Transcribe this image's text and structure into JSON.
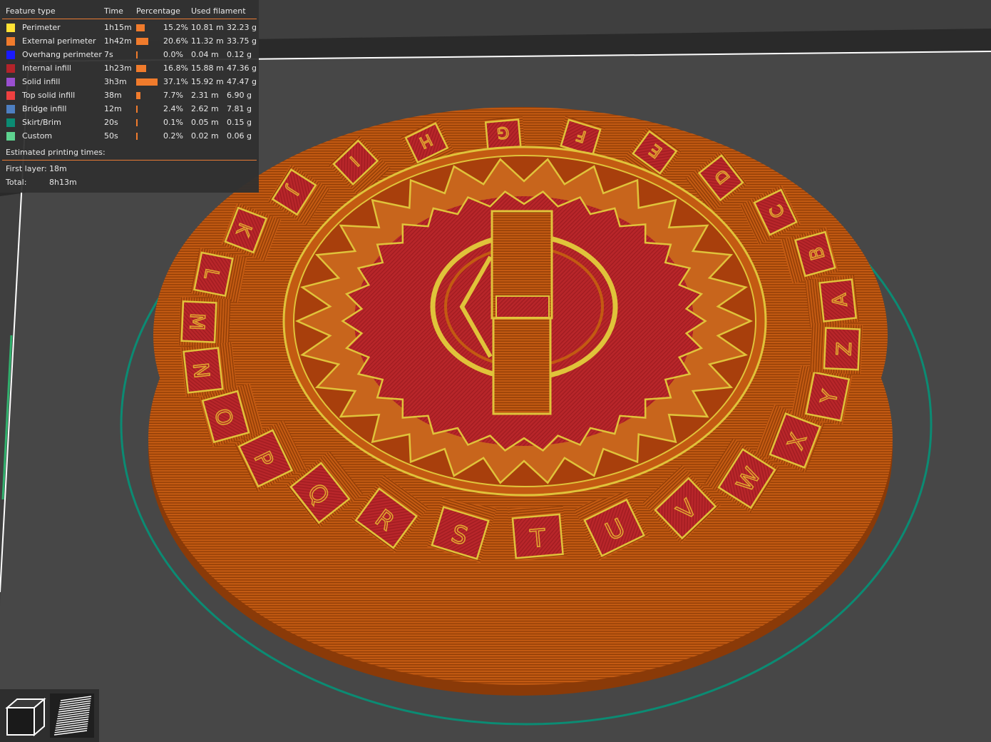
{
  "legend": {
    "headers": {
      "feature": "Feature type",
      "time": "Time",
      "percentage": "Percentage",
      "used": "Used filament"
    },
    "rows": [
      {
        "name": "Perimeter",
        "color": "#ffe234",
        "time": "1h15m",
        "pct": "15.2%",
        "pct_value": 15.2,
        "length": "10.81 m",
        "weight": "32.23 g"
      },
      {
        "name": "External perimeter",
        "color": "#f07b2c",
        "time": "1h42m",
        "pct": "20.6%",
        "pct_value": 20.6,
        "length": "11.32 m",
        "weight": "33.75 g"
      },
      {
        "name": "Overhang perimeter",
        "color": "#1a1aff",
        "time": "7s",
        "pct": "0.0%",
        "pct_value": 0.0,
        "length": "0.04 m",
        "weight": "0.12 g"
      },
      {
        "name": "Internal infill",
        "color": "#b3232a",
        "time": "1h23m",
        "pct": "16.8%",
        "pct_value": 16.8,
        "length": "15.88 m",
        "weight": "47.36 g"
      },
      {
        "name": "Solid infill",
        "color": "#9a4fd0",
        "time": "3h3m",
        "pct": "37.1%",
        "pct_value": 37.1,
        "length": "15.92 m",
        "weight": "47.47 g"
      },
      {
        "name": "Top solid infill",
        "color": "#ee4040",
        "time": "38m",
        "pct": "7.7%",
        "pct_value": 7.7,
        "length": "2.31 m",
        "weight": "6.90 g"
      },
      {
        "name": "Bridge infill",
        "color": "#4e7fc1",
        "time": "12m",
        "pct": "2.4%",
        "pct_value": 2.4,
        "length": "2.62 m",
        "weight": "7.81 g"
      },
      {
        "name": "Skirt/Brim",
        "color": "#0b8b73",
        "time": "20s",
        "pct": "0.1%",
        "pct_value": 0.1,
        "length": "0.05 m",
        "weight": "0.15 g"
      },
      {
        "name": "Custom",
        "color": "#5ed38f",
        "time": "50s",
        "pct": "0.2%",
        "pct_value": 0.2,
        "length": "0.02 m",
        "weight": "0.06 g"
      }
    ],
    "estimated_label": "Estimated printing times:",
    "first_layer_label": "First layer:",
    "first_layer_value": "18m",
    "total_label": "Total:",
    "total_value": "8h13m"
  },
  "model": {
    "outer_letters": [
      "A",
      "B",
      "C",
      "D",
      "E",
      "F",
      "G",
      "H",
      "I",
      "J",
      "K",
      "L",
      "M",
      "N",
      "O",
      "P",
      "Q",
      "R",
      "S",
      "T",
      "U",
      "V",
      "W",
      "X",
      "Y",
      "Z"
    ]
  },
  "view_buttons": [
    {
      "icon": "cube-3d-view-icon"
    },
    {
      "icon": "layers-preview-icon"
    }
  ]
}
